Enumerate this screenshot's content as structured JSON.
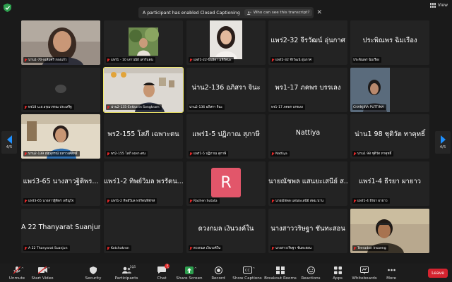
{
  "top_bar": {
    "banner_message": "A participant has enabled Closed Captioning",
    "banner_link": "Who can see this transcript?",
    "close_symbol": "✕",
    "view_label": "View"
  },
  "pager": {
    "left": "4/5",
    "right": "4/5"
  },
  "tiles": [
    {
      "name": "น่าน1-70-เฉลิมศรี กองแก้ว",
      "big": "",
      "muted": true
    },
    {
      "name": "แพร่1 - 10 เสาวณีย์ เสาร์แดน",
      "big": "",
      "muted": true
    },
    {
      "name": "แพร่1-22-ปิ่นธิดา มหิรัตนะ",
      "big": "",
      "muted": true
    },
    {
      "name": "แพร่2-32 จีรวัฒน์ อุ่นกาศ",
      "big": "แพร่2-32 จีรวัฒน์ อุ่นกาศ",
      "muted": true
    },
    {
      "name": "ประพิณพร ฉิมเรือง",
      "big": "ประพิณพร ฉิมเรือง",
      "muted": false
    },
    {
      "name": "พร18 น.ส.อรุณวรรณ ประเสริฐ",
      "big": "",
      "muted": true
    },
    {
      "name": "น่าน2-135-Eekkarin Songkram",
      "big": "",
      "muted": true
    },
    {
      "name": "น่าน2-136 อภิสรา จินะ",
      "big": "น่าน2-136 อภิสรา จินะ",
      "muted": false
    },
    {
      "name": "พร1-17 ภคพร บรรเลง",
      "big": "พร1-17 ภคพร บรรเลง",
      "muted": false
    },
    {
      "name": "CHANJIRA PUTTIMA",
      "big": "",
      "muted": false
    },
    {
      "name": "น่าน2-139 ณัฐสุภรณ์ มหาวงศ์สิทธิ์",
      "big": "",
      "muted": true
    },
    {
      "name": "พร2-155 โสภี เฉพาะตน",
      "big": "พร2-155 โสภี เฉพาะตน",
      "muted": true
    },
    {
      "name": "แพร่1-5 ปฏิภาณ สุภาษี",
      "big": "แพร่1-5 ปฏิภาณ สุภาษี",
      "muted": true
    },
    {
      "name": "Nattiya",
      "big": "Nattiya",
      "muted": true
    },
    {
      "name": "น่าน1 98 ชุติวัต ทาคุทธิ์",
      "big": "น่าน1 98 ชุติวัต ทาคุทธิ์",
      "muted": true
    },
    {
      "name": "แพร่3-65 นางสาวฐิติพร เจริญใจ",
      "big": "แพร่3-65 นางสาวฐิติพร...",
      "muted": true
    },
    {
      "name": "แพร่1-2 ทิพย์วิมล พรรัตนพิทักษ์",
      "big": "แพร่1-2 ทิพย์วิมล พรรัตน...",
      "muted": true
    },
    {
      "name": "Rachen Sutata",
      "big": "",
      "avatar": "R",
      "muted": true
    },
    {
      "name": "นายณัชพล แสนยะเสนีย์ สพม.น่าน",
      "big": "นายณัชพล แสนยะเสนีย์ ส...",
      "muted": true
    },
    {
      "name": "แพร่1-4 ธีรยา ผายาว",
      "big": "แพร่1-4 ธีรยา ผายาว",
      "muted": true
    },
    {
      "name": "A 22 Thanyarat Suanjun",
      "big": "A 22 Thanyarat Suanjun",
      "muted": true
    },
    {
      "name": "Kotchakron",
      "big": "",
      "muted": true
    },
    {
      "name": "ดวงกมล เงินวงค์ใน",
      "big": "ดวงกมล เงินวงค์ใน",
      "muted": true
    },
    {
      "name": "นางสาววริษฐา ชันทะสอน",
      "big": "นางสาววริษฐา ชันทะสอน",
      "muted": true
    },
    {
      "name": "Teeradon Insaeng",
      "big": "",
      "muted": true
    }
  ],
  "toolbar": {
    "unmute": "Unmute",
    "start_video": "Start Video",
    "security": "Security",
    "participants": "Participants",
    "participants_count": "105",
    "chat": "Chat",
    "chat_badge": "3",
    "share_screen": "Share Screen",
    "record": "Record",
    "show_captions": "Show Captions",
    "breakout_rooms": "Breakout Rooms",
    "reactions": "Reactions",
    "apps": "Apps",
    "whiteboards": "Whiteboards",
    "more": "More",
    "leave": "Leave"
  },
  "colors": {
    "background": "#1a1a1a",
    "tile": "#232323",
    "accent_blue": "#1e90ff",
    "share_green": "#2ea04f",
    "leave_red": "#d5232f",
    "avatar_pink": "#e2566a",
    "active_speaker": "#f2e96c"
  }
}
